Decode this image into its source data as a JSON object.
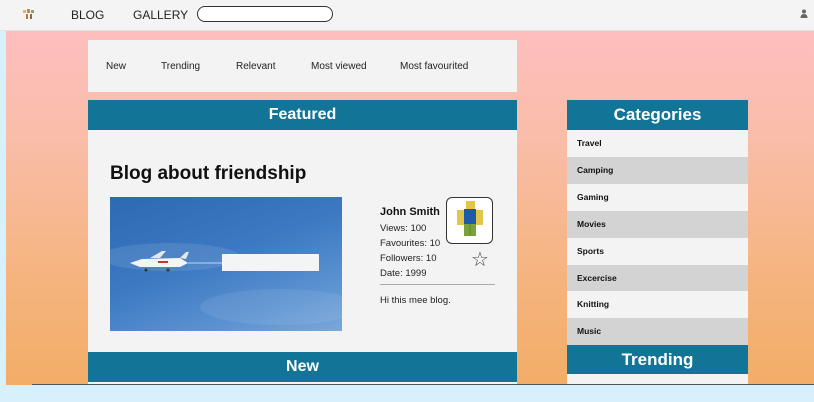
{
  "nav": {
    "blog": "BLOG",
    "gallery": "GALLERY",
    "search_placeholder": ""
  },
  "filters": [
    "New",
    "Trending",
    "Relevant",
    "Most viewed",
    "Most favourited"
  ],
  "featured": {
    "header": "Featured",
    "post": {
      "title": "Blog about friendship",
      "author": "John Smith",
      "views": "Views: 100",
      "favourites": "Favourites: 10",
      "followers": "Followers: 10",
      "date": "Date: 1999",
      "description": "Hi this mee blog."
    }
  },
  "new_section": {
    "header": "New"
  },
  "categories": {
    "header": "Categories",
    "items": [
      "Travel",
      "Camping",
      "Gaming",
      "Movies",
      "Sports",
      "Excercise",
      "Knitting",
      "Music"
    ]
  },
  "trending": {
    "header": "Trending"
  },
  "colors": {
    "accent": "#127496",
    "panel": "#f3f3f3",
    "row_alt": "#d3d3d3"
  },
  "icons": {
    "logo": "logo-icon",
    "user": "user-icon",
    "star": "star-icon",
    "avatar": "avatar"
  }
}
